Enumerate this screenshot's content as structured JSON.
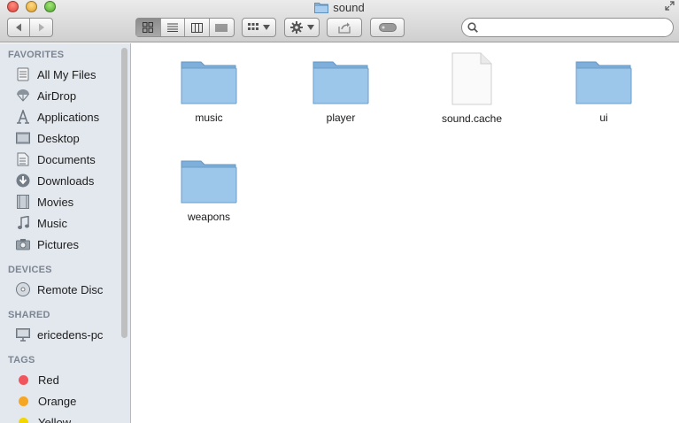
{
  "window": {
    "title": "sound"
  },
  "toolbar": {
    "search_placeholder": "",
    "view_modes": [
      "icon-view",
      "list-view",
      "column-view",
      "cover-flow-view"
    ],
    "active_view": "icon-view"
  },
  "sidebar": {
    "favorites_header": "FAVORITES",
    "favorites": [
      {
        "label": "All My Files",
        "icon": "all-my-files-icon"
      },
      {
        "label": "AirDrop",
        "icon": "airdrop-icon"
      },
      {
        "label": "Applications",
        "icon": "applications-icon"
      },
      {
        "label": "Desktop",
        "icon": "desktop-icon"
      },
      {
        "label": "Documents",
        "icon": "documents-icon"
      },
      {
        "label": "Downloads",
        "icon": "downloads-icon"
      },
      {
        "label": "Movies",
        "icon": "movies-icon"
      },
      {
        "label": "Music",
        "icon": "music-icon"
      },
      {
        "label": "Pictures",
        "icon": "pictures-icon"
      }
    ],
    "devices_header": "DEVICES",
    "devices": [
      {
        "label": "Remote Disc",
        "icon": "remote-disc-icon"
      }
    ],
    "shared_header": "SHARED",
    "shared": [
      {
        "label": "ericedens-pc",
        "icon": "pc-icon"
      }
    ],
    "tags_header": "TAGS",
    "tags": [
      {
        "label": "Red",
        "color": "#f0545c"
      },
      {
        "label": "Orange",
        "color": "#f5a623"
      },
      {
        "label": "Yellow",
        "color": "#f2d600"
      }
    ]
  },
  "files": [
    {
      "name": "music",
      "kind": "folder"
    },
    {
      "name": "player",
      "kind": "folder"
    },
    {
      "name": "sound.cache",
      "kind": "document"
    },
    {
      "name": "ui",
      "kind": "folder"
    },
    {
      "name": "weapons",
      "kind": "folder"
    }
  ]
}
